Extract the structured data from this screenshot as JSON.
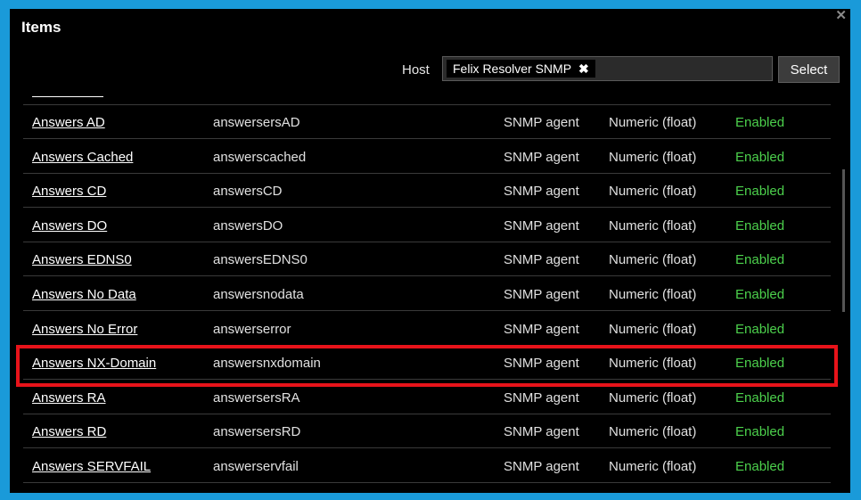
{
  "dialog": {
    "title": "Items",
    "close_icon": "close-icon"
  },
  "filter": {
    "host_label": "Host",
    "selected_host": "Felix Resolver SNMP",
    "remove_icon": "close-icon",
    "select_button": "Select"
  },
  "items": [
    {
      "name": "Answers AD",
      "key": "answersersAD",
      "type": "SNMP agent",
      "value_type": "Numeric (float)",
      "status": "Enabled"
    },
    {
      "name": "Answers Cached",
      "key": "answerscached",
      "type": "SNMP agent",
      "value_type": "Numeric (float)",
      "status": "Enabled"
    },
    {
      "name": "Answers CD",
      "key": "answersCD",
      "type": "SNMP agent",
      "value_type": "Numeric (float)",
      "status": "Enabled"
    },
    {
      "name": "Answers DO",
      "key": "answersDO",
      "type": "SNMP agent",
      "value_type": "Numeric (float)",
      "status": "Enabled"
    },
    {
      "name": "Answers EDNS0",
      "key": "answersEDNS0",
      "type": "SNMP agent",
      "value_type": "Numeric (float)",
      "status": "Enabled"
    },
    {
      "name": "Answers No Data",
      "key": "answersnodata",
      "type": "SNMP agent",
      "value_type": "Numeric (float)",
      "status": "Enabled"
    },
    {
      "name": "Answers No Error",
      "key": "answerserror",
      "type": "SNMP agent",
      "value_type": "Numeric (float)",
      "status": "Enabled"
    },
    {
      "name": "Answers NX-Domain",
      "key": "answersnxdomain",
      "type": "SNMP agent",
      "value_type": "Numeric (float)",
      "status": "Enabled"
    },
    {
      "name": "Answers RA",
      "key": "answersersRA",
      "type": "SNMP agent",
      "value_type": "Numeric (float)",
      "status": "Enabled"
    },
    {
      "name": "Answers RD",
      "key": "answersersRD",
      "type": "SNMP agent",
      "value_type": "Numeric (float)",
      "status": "Enabled"
    },
    {
      "name": "Answers SERVFAIL",
      "key": "answerservfail",
      "type": "SNMP agent",
      "value_type": "Numeric (float)",
      "status": "Enabled"
    }
  ],
  "colors": {
    "background": "#000000",
    "frame": "#1a9ad9",
    "enabled": "#4cd04c",
    "highlight": "#e8131a"
  }
}
